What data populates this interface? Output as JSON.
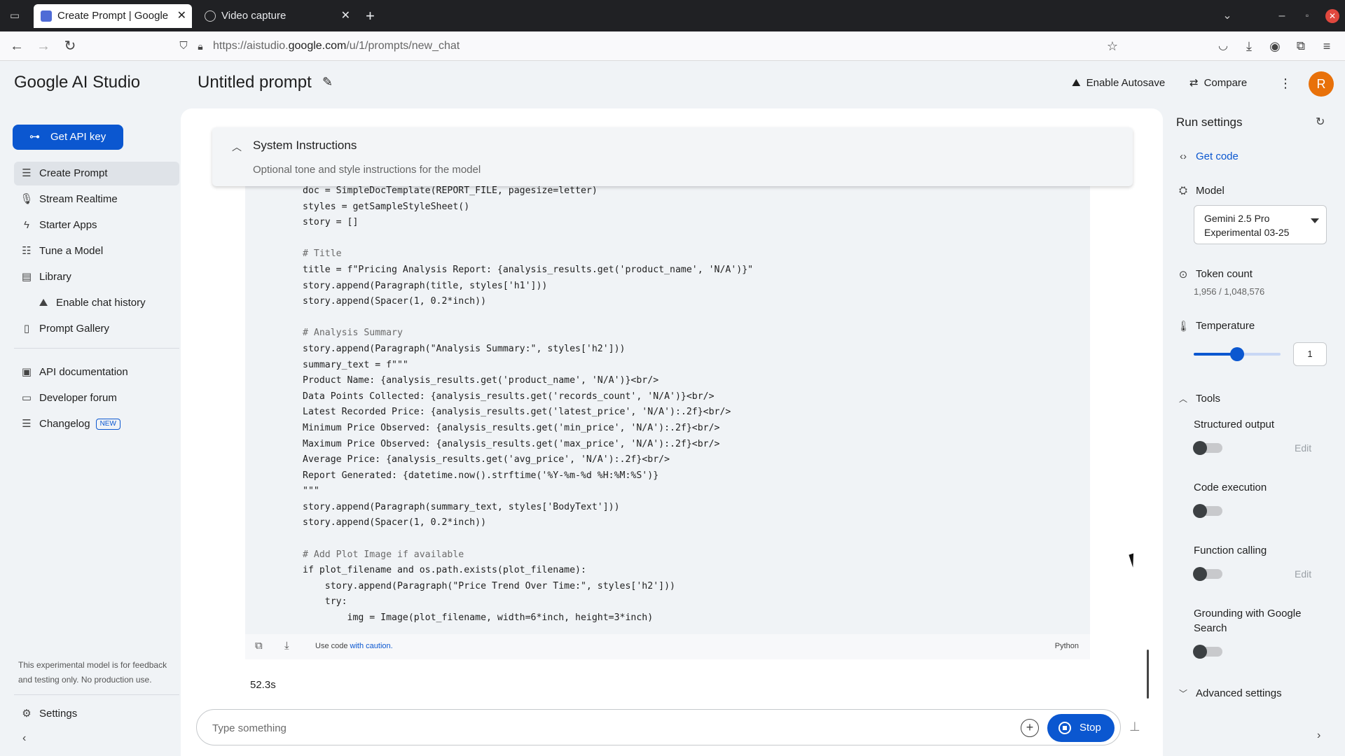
{
  "browser": {
    "tabs": [
      {
        "title": "Create Prompt | Google AI Studio",
        "active": true,
        "icon": "ai-studio-favicon"
      },
      {
        "title": "Video capture",
        "active": false,
        "icon": "globe-icon"
      }
    ],
    "close_glyph": "✕",
    "new_tab_glyph": "+",
    "url_prefix": "https://aistudio.",
    "url_host": "google.com",
    "url_path": "/u/1/prompts/new_chat"
  },
  "app": {
    "logo": "Google AI Studio",
    "prompt_title": "Untitled prompt",
    "autosave_label": "Enable Autosave",
    "compare_label": "Compare",
    "avatar_initial": "R"
  },
  "sidebar": {
    "api_key_label": "Get API key",
    "items": [
      {
        "label": "Create Prompt",
        "icon": "prompt-icon"
      },
      {
        "label": "Stream Realtime",
        "icon": "microphone-icon"
      },
      {
        "label": "Starter Apps",
        "icon": "bolt-icon"
      },
      {
        "label": "Tune a Model",
        "icon": "tune-icon"
      },
      {
        "label": "Library",
        "icon": "library-icon"
      },
      {
        "label": "Enable chat history",
        "icon": "history-icon"
      },
      {
        "label": "Prompt Gallery",
        "icon": "gallery-icon"
      },
      {
        "label": "API documentation",
        "icon": "docs-icon"
      },
      {
        "label": "Developer forum",
        "icon": "forum-icon"
      },
      {
        "label": "Changelog",
        "icon": "changelog-icon",
        "badge": "NEW"
      }
    ],
    "note": "This experimental model is for feedback and testing only. No production use.",
    "settings_label": "Settings"
  },
  "system_instructions": {
    "title": "System Instructions",
    "placeholder": "Optional tone and style instructions for the model"
  },
  "code": {
    "lines": [
      "doc = SimpleDocTemplate(REPORT_FILE, pagesize=letter)",
      "styles = getSampleStyleSheet()",
      "story = []",
      "",
      "# Title",
      "title = f\"Pricing Analysis Report: {analysis_results.get('product_name', 'N/A')}\"",
      "story.append(Paragraph(title, styles['h1']))",
      "story.append(Spacer(1, 0.2*inch))",
      "",
      "# Analysis Summary",
      "story.append(Paragraph(\"Analysis Summary:\", styles['h2']))",
      "summary_text = f\"\"\"",
      "Product Name: {analysis_results.get('product_name', 'N/A')}<br/>",
      "Data Points Collected: {analysis_results.get('records_count', 'N/A')}<br/>",
      "Latest Recorded Price: {analysis_results.get('latest_price', 'N/A'):.2f}<br/>",
      "Minimum Price Observed: {analysis_results.get('min_price', 'N/A'):.2f}<br/>",
      "Maximum Price Observed: {analysis_results.get('max_price', 'N/A'):.2f}<br/>",
      "Average Price: {analysis_results.get('avg_price', 'N/A'):.2f}<br/>",
      "Report Generated: {datetime.now().strftime('%Y-%m-%d %H:%M:%S')}",
      "\"\"\"",
      "story.append(Paragraph(summary_text, styles['BodyText']))",
      "story.append(Spacer(1, 0.2*inch))",
      "",
      "# Add Plot Image if available",
      "if plot_filename and os.path.exists(plot_filename):",
      "    story.append(Paragraph(\"Price Trend Over Time:\", styles['h2']))",
      "    try:",
      "        img = Image(plot_filename, width=6*inch, height=3*inch)"
    ],
    "footer_note": "Use code ",
    "footer_link": "with caution.",
    "language": "Python"
  },
  "run": {
    "elapsed": "52.3s",
    "input_placeholder": "Type something",
    "stop_label": "Stop"
  },
  "run_settings": {
    "title": "Run settings",
    "get_code": "Get code",
    "model_label": "Model",
    "model_value": "Gemini 2.5 Pro Experimental 03-25",
    "token_label": "Token count",
    "token_value": "1,956 / 1,048,576",
    "temperature_label": "Temperature",
    "temperature_value": "1",
    "temperature_fraction": 0.5,
    "tools_label": "Tools",
    "tools": [
      {
        "label": "Structured output",
        "enabled": false,
        "edit": "Edit"
      },
      {
        "label": "Code execution",
        "enabled": false,
        "edit": ""
      },
      {
        "label": "Function calling",
        "enabled": false,
        "edit": "Edit"
      },
      {
        "label": "Grounding with Google Search",
        "enabled": false,
        "edit": ""
      }
    ],
    "advanced_label": "Advanced settings"
  },
  "colors": {
    "accent": "#0b57d0",
    "avatar": "#e8710a"
  }
}
